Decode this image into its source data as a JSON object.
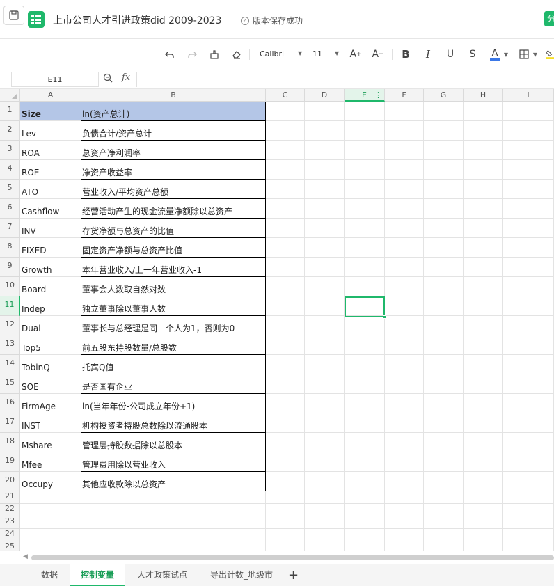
{
  "app": {
    "doc_title": "上市公司人才引进政策did 2009-2023",
    "save_status": "版本保存成功",
    "share_label": "分享"
  },
  "toolbar": {
    "font_name": "Calibri",
    "font_size": "11",
    "icons": [
      "undo-icon",
      "redo-icon",
      "format-painter-icon",
      "eraser-icon",
      "increase-font-icon",
      "decrease-font-icon",
      "bold-icon",
      "italic-icon",
      "underline-icon",
      "strikethrough-icon",
      "font-color-icon",
      "border-icon",
      "highlight-icon"
    ],
    "font_color_accent": "#3b78e7",
    "highlight_accent": "#f5d800"
  },
  "formula_bar": {
    "cell_ref": "E11",
    "fx_label": "fx",
    "value": ""
  },
  "sheet": {
    "columns": [
      "A",
      "B",
      "C",
      "D",
      "E",
      "F",
      "G",
      "H",
      "I"
    ],
    "selected_column": "E",
    "selected_row": "11",
    "row_numbers": [
      "1",
      "2",
      "3",
      "4",
      "5",
      "6",
      "7",
      "8",
      "9",
      "10",
      "11",
      "12",
      "13",
      "14",
      "15",
      "16",
      "17",
      "18",
      "19",
      "20",
      "21",
      "22",
      "23",
      "24",
      "25"
    ],
    "header_fill_color": "#b4c6e7",
    "rows": [
      {
        "a": "Size",
        "b": "ln(资产总计)"
      },
      {
        "a": "Lev",
        "b": "负债合计/资产总计"
      },
      {
        "a": "ROA",
        "b": "总资产净利润率"
      },
      {
        "a": "ROE",
        "b": "净资产收益率"
      },
      {
        "a": "ATO",
        "b": "营业收入/平均资产总额"
      },
      {
        "a": "Cashflow",
        "b": "经营活动产生的现金流量净额除以总资产"
      },
      {
        "a": "INV",
        "b": "存货净额与总资产的比值"
      },
      {
        "a": "FIXED",
        "b": "固定资产净额与总资产比值"
      },
      {
        "a": "Growth",
        "b": "本年营业收入/上一年营业收入-1"
      },
      {
        "a": "Board",
        "b": "董事会人数取自然对数"
      },
      {
        "a": "Indep",
        "b": "独立董事除以董事人数"
      },
      {
        "a": "Dual",
        "b": "董事长与总经理是同一个人为1，否则为0"
      },
      {
        "a": "Top5",
        "b": "前五股东持股数量/总股数"
      },
      {
        "a": "TobinQ",
        "b": "托宾Q值"
      },
      {
        "a": "SOE",
        "b": "是否国有企业"
      },
      {
        "a": "FirmAge",
        "b": "ln(当年年份-公司成立年份+1)"
      },
      {
        "a": "INST",
        "b": "机构投资者持股总数除以流通股本"
      },
      {
        "a": "Mshare",
        "b": "管理层持股数据除以总股本"
      },
      {
        "a": "Mfee",
        "b": "管理费用除以营业收入"
      },
      {
        "a": "Occupy",
        "b": "其他应收款除以总资产"
      }
    ]
  },
  "tabs": {
    "items": [
      "数据",
      "控制变量",
      "人才政策试点",
      "导出计数_地级市"
    ],
    "active": "控制变量"
  }
}
